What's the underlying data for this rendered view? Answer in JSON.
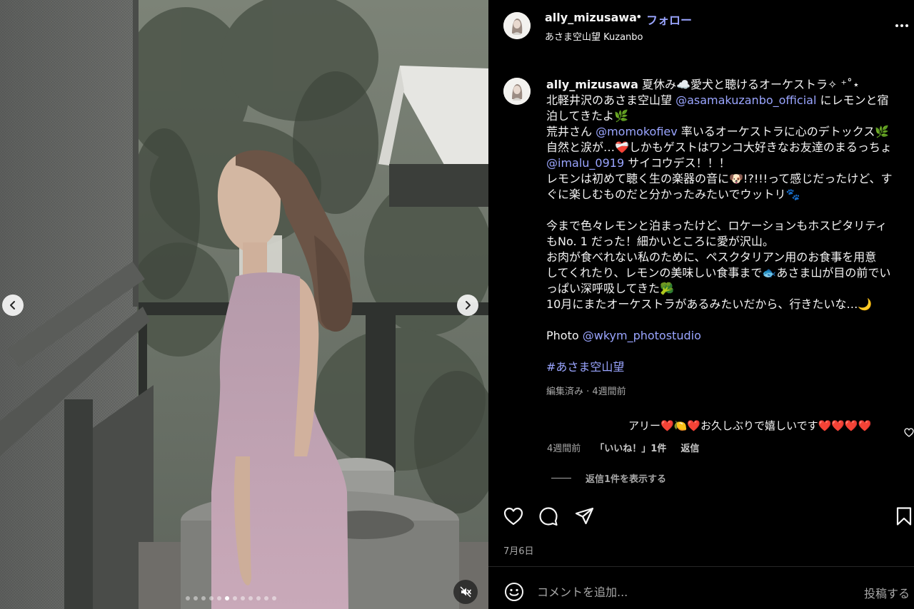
{
  "header": {
    "username": "ally_mizusawa",
    "separator": "•",
    "follow_label": "フォロー",
    "location": "あさま空山望 Kuzanbo"
  },
  "caption": {
    "username": "ally_mizusawa",
    "lines": [
      {
        "parts": [
          {
            "t": "夏休み☁️愛犬と聴けるオーケストラ✧ ⁺˚⋆"
          }
        ]
      },
      {
        "parts": [
          {
            "t": "北軽井沢のあさま空山望 "
          },
          {
            "t": "@asamakuzanbo_official",
            "m": true
          },
          {
            "t": " にレモンと宿"
          }
        ]
      },
      {
        "parts": [
          {
            "t": "泊してきたよ🌿"
          }
        ]
      },
      {
        "parts": [
          {
            "t": "荒井さん "
          },
          {
            "t": "@momokofiev",
            "m": true
          },
          {
            "t": " 率いるオーケストラに心のデトックス🌿"
          }
        ]
      },
      {
        "parts": [
          {
            "t": "自然と涙が…❤️‍🩹しかもゲストはワンコ大好きなお友達のまるっちょ"
          }
        ]
      },
      {
        "parts": [
          {
            "t": "@imalu_0919",
            "m": true
          },
          {
            "t": " サイコウデス！！！"
          }
        ]
      },
      {
        "parts": [
          {
            "t": "レモンは初めて聴く生の楽器の音に🐶!?!!!って感じだったけど、す"
          }
        ]
      },
      {
        "parts": [
          {
            "t": "ぐに楽しむものだと分かったみたいでウットリ🐾"
          }
        ]
      },
      {
        "blank": true
      },
      {
        "parts": [
          {
            "t": "今まで色々レモンと泊まったけど、ロケーションもホスピタリティ"
          }
        ]
      },
      {
        "parts": [
          {
            "t": "もNo. 1 だった！細かいところに愛が沢山。"
          }
        ]
      },
      {
        "parts": [
          {
            "t": "お肉が食べれない私のために、ペスクタリアン用のお食事を用意"
          }
        ]
      },
      {
        "parts": [
          {
            "t": "してくれたり、レモンの美味しい食事まで🐟あさま山が目の前でい"
          }
        ]
      },
      {
        "parts": [
          {
            "t": "っぱい深呼吸してきた🥦"
          }
        ]
      },
      {
        "parts": [
          {
            "t": "10月にまたオーケストラがあるみたいだから、行きたいな…🌙"
          }
        ]
      },
      {
        "blank": true
      },
      {
        "parts": [
          {
            "t": "Photo "
          },
          {
            "t": "@wkym_photostudio",
            "m": true
          }
        ]
      },
      {
        "blank": true
      },
      {
        "parts": [
          {
            "t": "#あさま空山望",
            "m": true
          }
        ]
      }
    ],
    "meta": "編集済み · 4週間前"
  },
  "reply": {
    "text": "アリー❤️🍋❤️お久しぶりで嬉しいです❤️❤️❤️❤️",
    "time": "4週間前",
    "likes": "「いいね！」1件",
    "reply_label": "返信",
    "view_replies": "返信1件を表示する"
  },
  "post": {
    "date": "7月6日",
    "comment_placeholder": "コメントを追加...",
    "post_label": "投稿する"
  },
  "carousel": {
    "slide_count": 12,
    "active_index": 5
  },
  "icons": {
    "nav_prev": "chevron-left-icon",
    "nav_next": "chevron-right-icon",
    "mute": "speaker-muted-icon",
    "more": "more-horizontal-icon",
    "like": "heart-icon",
    "comment": "comment-bubble-icon",
    "share": "paper-plane-icon",
    "save": "bookmark-icon",
    "emoji": "smiley-icon"
  },
  "colors": {
    "link": "#9aa5ff",
    "muted_text": "#a8a8a8",
    "background": "#000000"
  }
}
